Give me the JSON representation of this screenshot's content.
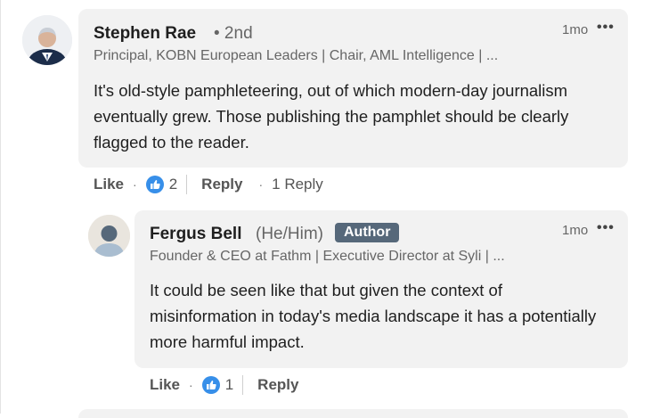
{
  "ui": {
    "dot": "·"
  },
  "comments": [
    {
      "name": "Stephen Rae",
      "degree": "• 2nd",
      "headline": "Principal, KOBN European Leaders | Chair, AML Intelligence | ...",
      "time": "1mo",
      "text": "It's old-style pamphleteering, out of which modern-day journalism eventually grew. Those publishing the pamphlet should be clearly flagged to the reader.",
      "like_label": "Like",
      "reactions": "2",
      "reply_label": "Reply",
      "reply_count": "1 Reply",
      "icons": {
        "avatar": "person-photo",
        "reaction": "like-reaction",
        "menu": "more-options"
      }
    },
    {
      "name": "Fergus Bell",
      "pronouns": "(He/Him)",
      "badge": "Author",
      "headline": "Founder & CEO at Fathm | Executive Director at Syli | ...",
      "time": "1mo",
      "text": "It could be seen like that but given the context of misinformation in today's media landscape it has a potentially more harmful impact.",
      "like_label": "Like",
      "reactions": "1",
      "reply_label": "Reply",
      "icons": {
        "avatar": "default-person",
        "reaction": "like-reaction",
        "menu": "more-options"
      }
    }
  ],
  "colors": {
    "accent": "#378fe9",
    "badge": "#56687a",
    "bubble": "#f2f2f2"
  }
}
